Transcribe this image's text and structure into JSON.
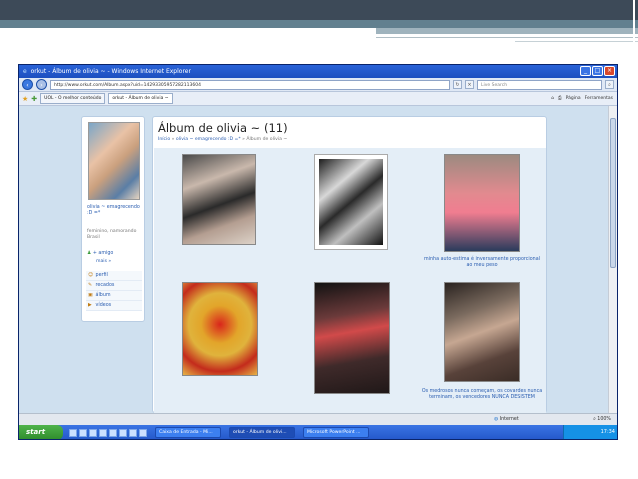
{
  "browser": {
    "title": "orkut - Álbum de olivia ~ - Windows Internet Explorer",
    "url": "http://www.orkut.com/Album.aspx?uid=14293305957282113604",
    "search_placeholder": "Live Search",
    "tabs": [
      {
        "label": "UOL - O melhor conteúdo"
      },
      {
        "label": "orkut - Álbum de olivia ~"
      }
    ],
    "toolbar": {
      "page": "Página",
      "tools": "Ferramentas"
    }
  },
  "profile": {
    "name": "olivia ~ emagrecendo :D =*",
    "details": "feminino, namorando Brasil",
    "friend_link": "+ amigo",
    "more_link": "mais »",
    "menu": [
      {
        "icon": "profile-icon",
        "label": "perfil"
      },
      {
        "icon": "scraps-icon",
        "label": "recados"
      },
      {
        "icon": "album-icon",
        "label": "álbum"
      },
      {
        "icon": "video-icon",
        "label": "vídeos"
      }
    ]
  },
  "album": {
    "title": "Álbum de olivia ~ (11)",
    "breadcrumb_home": "Início",
    "breadcrumb_profile": "olivia ~ emagrecendo :D =*",
    "breadcrumb_current": "Álbum de olivia ~",
    "photos": [
      {
        "caption": ""
      },
      {
        "caption": ""
      },
      {
        "caption": "minha auto-estima é inversamente proporcional ao meu peso"
      },
      {
        "caption": ""
      },
      {
        "caption": ""
      },
      {
        "caption": "Os medrosos nunca começam, os covardes nunca terminam, os vencedores NUNCA DESISTEM"
      }
    ]
  },
  "status": {
    "zone": "Internet",
    "zoom": "100%"
  },
  "taskbar": {
    "start": "start",
    "tasks": [
      {
        "label": "Caixa de Entrada - Mi..."
      },
      {
        "label": "orkut - Álbum de olivi..."
      },
      {
        "label": "Microsoft PowerPoint ..."
      }
    ],
    "clock": "17:34"
  }
}
